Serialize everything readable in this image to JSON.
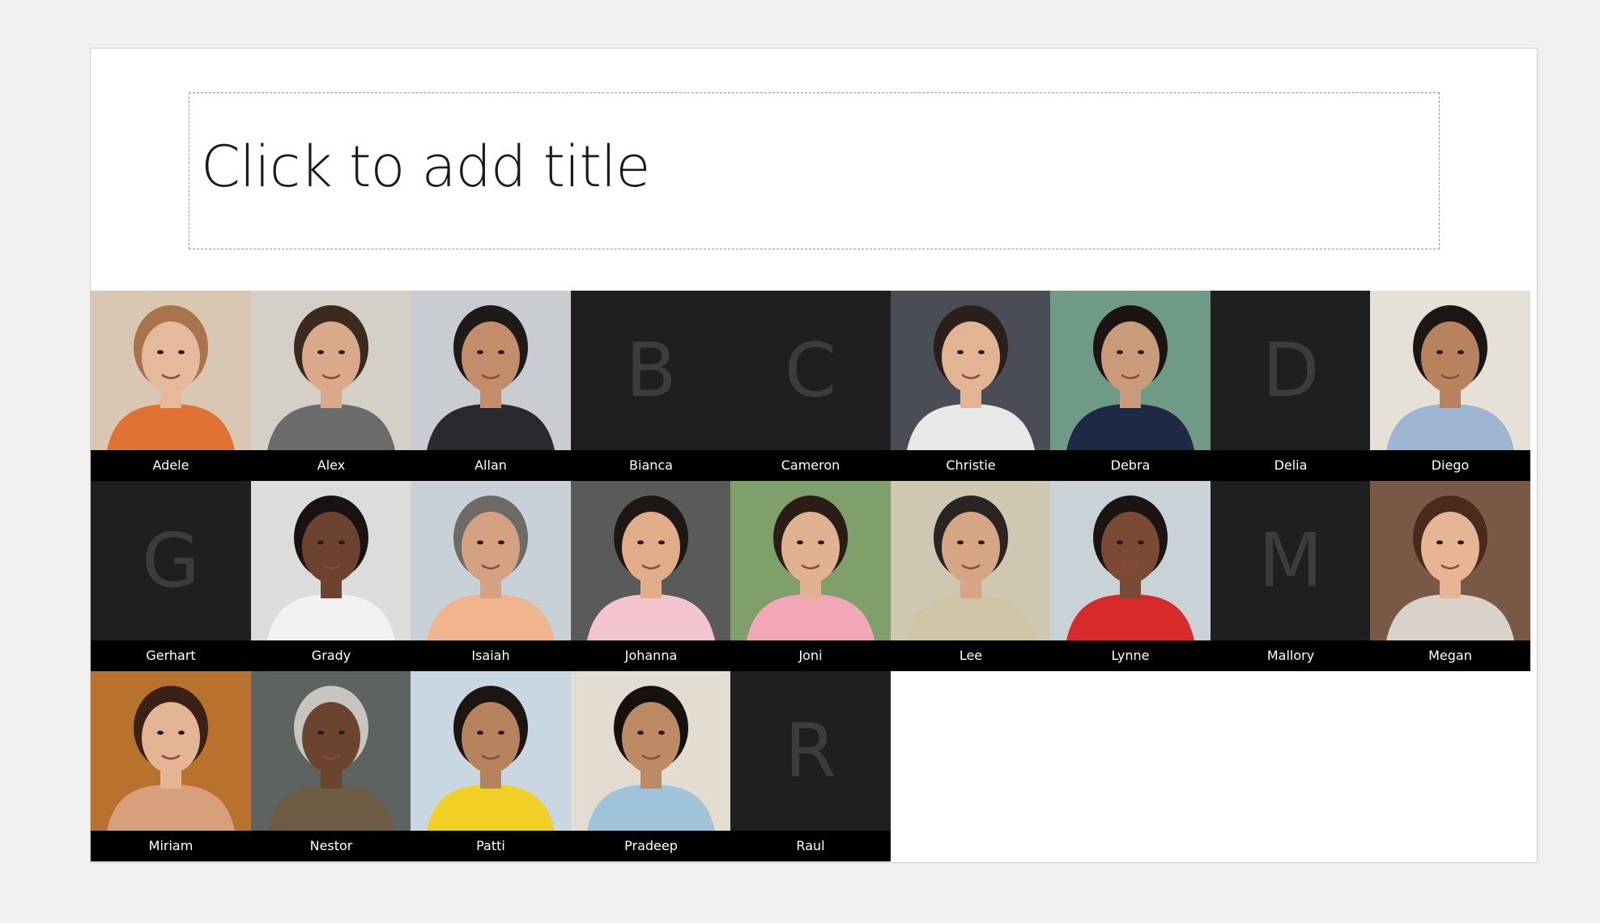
{
  "slide": {
    "title_placeholder": "Click to add title"
  },
  "people": [
    {
      "name": "Adele",
      "bg": "#d9c6b3",
      "skin": "#e6b99c",
      "hair": "#a7744b",
      "shirt": "#e07234"
    },
    {
      "name": "Alex",
      "bg": "#d4d0c8",
      "skin": "#d9a98a",
      "hair": "#3b2a20",
      "shirt": "#6b6b6b"
    },
    {
      "name": "Allan",
      "bg": "#c9ccd0",
      "skin": "#c38c6a",
      "hair": "#1e1a18",
      "shirt": "#2a2a2e"
    },
    {
      "name": "Bianca",
      "initial": "B"
    },
    {
      "name": "Cameron",
      "initial": "C"
    },
    {
      "name": "Christie",
      "bg": "#4a4d55",
      "skin": "#e2b493",
      "hair": "#2a1f1a",
      "shirt": "#e8e8e8"
    },
    {
      "name": "Debra",
      "bg": "#6f9a86",
      "skin": "#c99b7a",
      "hair": "#1a1412",
      "shirt": "#1e2a45"
    },
    {
      "name": "Delia",
      "initial": "D"
    },
    {
      "name": "Diego",
      "bg": "#e6e1d7",
      "skin": "#b8825f",
      "hair": "#1c1714",
      "shirt": "#9fb6d3"
    },
    {
      "name": "Gerhart",
      "initial": "G"
    },
    {
      "name": "Grady",
      "bg": "#dcdcdc",
      "skin": "#6b4330",
      "hair": "#1a1210",
      "shirt": "#f2f2f2"
    },
    {
      "name": "Isaiah",
      "bg": "#c9d1d8",
      "skin": "#d4a283",
      "hair": "#6e6b66",
      "shirt": "#f0b48f"
    },
    {
      "name": "Johanna",
      "bg": "#5a5a5a",
      "skin": "#e0ac8a",
      "hair": "#1e1714",
      "shirt": "#f2c4cd"
    },
    {
      "name": "Joni",
      "bg": "#7fa06a",
      "skin": "#e1b291",
      "hair": "#2b1d16",
      "shirt": "#f2a7b6"
    },
    {
      "name": "Lee",
      "bg": "#cfc7b2",
      "skin": "#d5a586",
      "hair": "#2a2522",
      "shirt": "#cfc4a6"
    },
    {
      "name": "Lynne",
      "bg": "#c9d2d6",
      "skin": "#7a4a34",
      "hair": "#1b1412",
      "shirt": "#d72a2a"
    },
    {
      "name": "Mallory",
      "initial": "M"
    },
    {
      "name": "Megan",
      "bg": "#7a5846",
      "skin": "#e6b596",
      "hair": "#4a2a1c",
      "shirt": "#d9d2c9"
    },
    {
      "name": "Miriam",
      "bg": "#b8722e",
      "skin": "#e4b595",
      "hair": "#3a2116",
      "shirt": "#d8a07a"
    },
    {
      "name": "Nestor",
      "bg": "#5d6360",
      "skin": "#6b4430",
      "hair": "#c8c4bf",
      "shirt": "#6e5b43"
    },
    {
      "name": "Patti",
      "bg": "#c9d7e3",
      "skin": "#b7835f",
      "hair": "#1c1512",
      "shirt": "#f1cf25"
    },
    {
      "name": "Pradeep",
      "bg": "#e2ddd0",
      "skin": "#bd8a66",
      "hair": "#17110e",
      "shirt": "#9fc3d9"
    },
    {
      "name": "Raul",
      "initial": "R"
    }
  ]
}
